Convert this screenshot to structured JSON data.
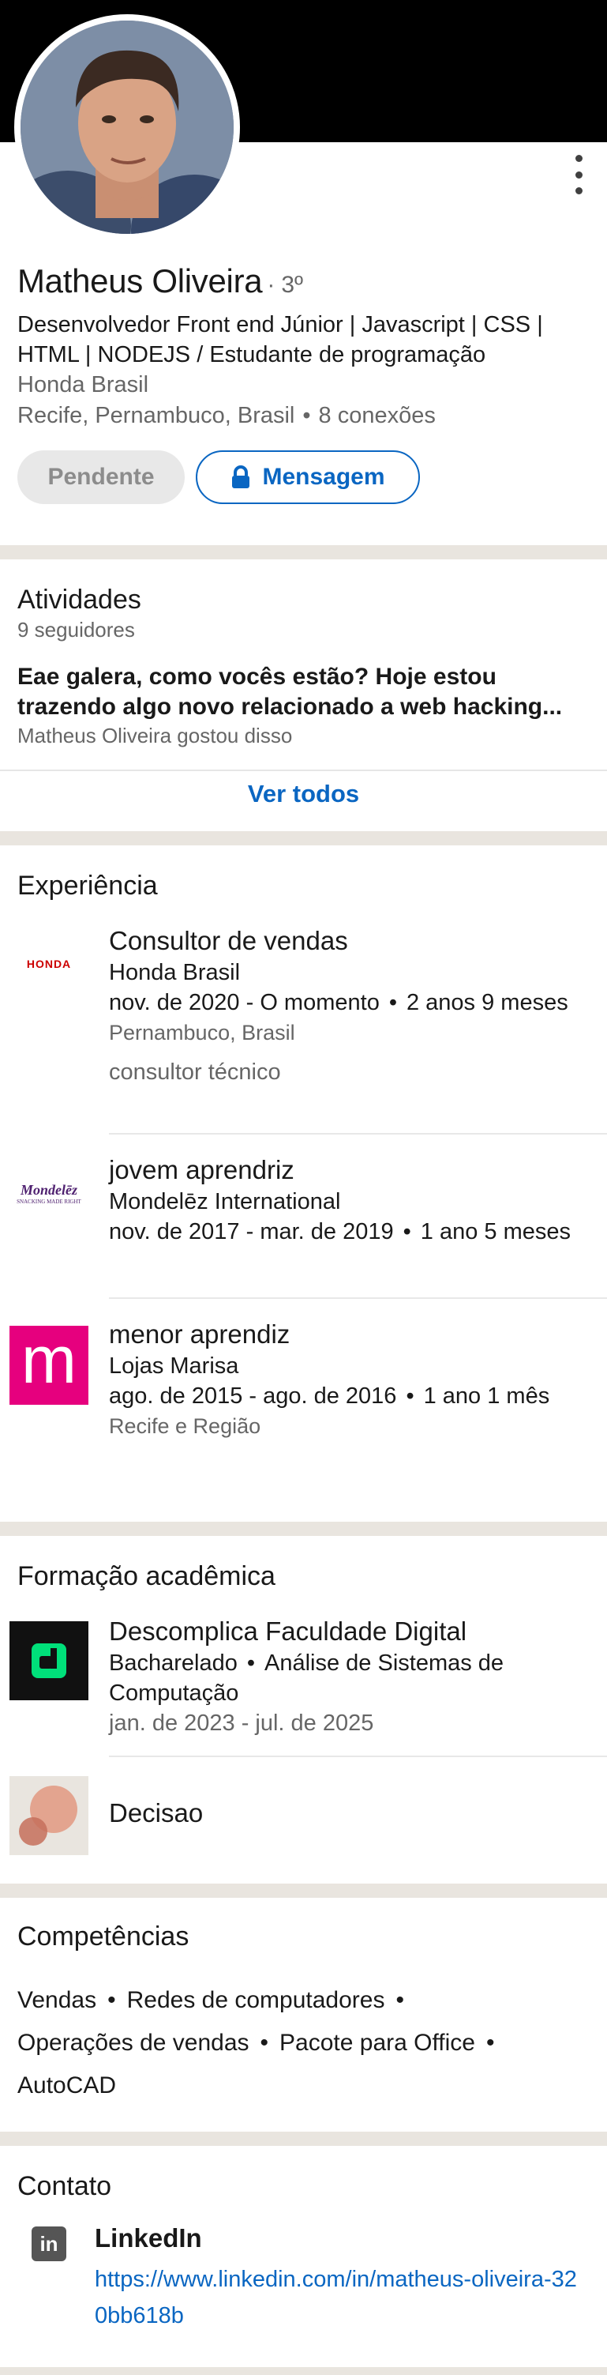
{
  "profile": {
    "name": "Matheus Oliveira",
    "degree": "3º",
    "headline": "Desenvolvedor Front end Júnior | Javascript | CSS | HTML | NODEJS / Estudante de programação",
    "company": "Honda Brasil",
    "location": "Recife, Pernambuco, Brasil",
    "connections": "8 conexões",
    "pending_label": "Pendente",
    "message_label": "Mensagem"
  },
  "activity": {
    "title": "Atividades",
    "followers": "9 seguidores",
    "post_line1": "Eae galera, como vocês estão? Hoje estou",
    "post_line2": "trazendo algo novo relacionado a web hacking...",
    "post_meta": "Matheus Oliveira gostou disso",
    "see_all": "Ver todos"
  },
  "experience": {
    "title": "Experiência",
    "items": [
      {
        "logo": "honda-logo",
        "logo_text": "HONDA",
        "role": "Consultor de vendas",
        "company": "Honda Brasil",
        "period": "nov. de 2020 - O momento",
        "duration": "2 anos 9 meses",
        "location": "Pernambuco, Brasil",
        "description": "consultor técnico"
      },
      {
        "logo": "mondelez-logo",
        "logo_text": "Mondelēz",
        "logo_subtext": "SNACKING MADE RIGHT",
        "role": "jovem aprendriz",
        "company": "Mondelēz International",
        "period": "nov. de 2017 - mar. de 2019",
        "duration": "1 ano 5 meses"
      },
      {
        "logo": "lojas-marisa-logo",
        "logo_text": "m",
        "role": "menor aprendiz",
        "company": "Lojas Marisa",
        "period": "ago. de 2015 - ago. de 2016",
        "duration": "1 ano 1 mês",
        "location": "Recife e Região"
      }
    ]
  },
  "education": {
    "title": "Formação acadêmica",
    "items": [
      {
        "logo": "descomplica-logo",
        "school": "Descomplica Faculdade Digital",
        "degree": "Bacharelado",
        "field": "Análise de Sistemas de Computação",
        "period": "jan. de 2023 - jul. de 2025"
      },
      {
        "logo": "generic-school-logo",
        "school": "Decisao"
      }
    ]
  },
  "skills": {
    "title": "Competências",
    "items": [
      "Vendas",
      "Redes de computadores",
      "Operações de vendas",
      "Pacote para Office",
      "AutoCAD"
    ]
  },
  "contact": {
    "title": "Contato",
    "label": "LinkedIn",
    "icon": "linkedin-icon",
    "url": "https://www.linkedin.com/in/matheus-oliveira-320bb618b"
  },
  "colors": {
    "accent": "#0a66c2",
    "divider": "#e9e5df",
    "banner": "#000000",
    "marisa": "#e6007e",
    "descomplica": "#00e07a"
  }
}
